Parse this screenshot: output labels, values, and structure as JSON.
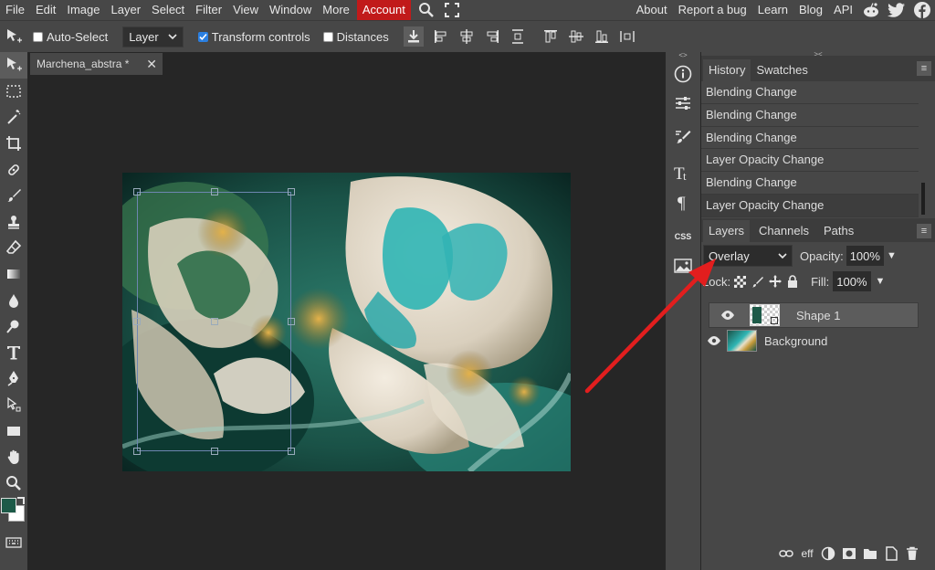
{
  "menu": {
    "items": [
      "File",
      "Edit",
      "Image",
      "Layer",
      "Select",
      "Filter",
      "View",
      "Window",
      "More"
    ],
    "account": "Account",
    "right_links": [
      "About",
      "Report a bug",
      "Learn",
      "Blog",
      "API"
    ]
  },
  "options": {
    "auto_select": "Auto-Select",
    "layer_select": "Layer",
    "transform_controls": "Transform controls",
    "distances": "Distances"
  },
  "document": {
    "tab_title": "Marchena_abstra *"
  },
  "history_panel": {
    "tabs": [
      "History",
      "Swatches"
    ],
    "items": [
      "Blending Change",
      "Blending Change",
      "Blending Change",
      "Layer Opacity Change",
      "Blending Change",
      "Layer Opacity Change"
    ]
  },
  "layers_panel": {
    "tabs": [
      "Layers",
      "Channels",
      "Paths"
    ],
    "blend_mode": "Overlay",
    "opacity_label": "Opacity:",
    "opacity_value": "100%",
    "lock_label": "Lock:",
    "fill_label": "Fill:",
    "fill_value": "100%",
    "layers": [
      {
        "name": "Shape 1",
        "selected": true
      },
      {
        "name": "Background",
        "selected": false
      }
    ],
    "footer_fx": "eff"
  },
  "midcol": {
    "css_label": "CSS"
  },
  "colors": {
    "foreground": "#1d5a48",
    "background": "#ffffff",
    "account_red": "#c11a1a",
    "arrow_red": "#e21e1e"
  }
}
